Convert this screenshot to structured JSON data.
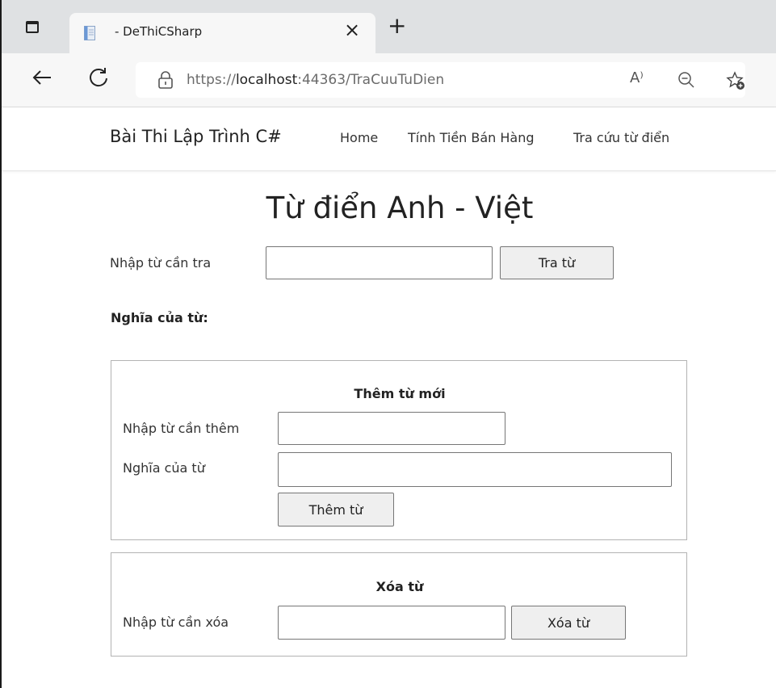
{
  "browser": {
    "tab_title": "- DeThiCSharp",
    "tab_close": "×",
    "new_tab": "+",
    "url_prefix": "https://",
    "url_host": "localhost",
    "url_rest": ":44363/TraCuuTuDien",
    "read_aloud": "A⁾"
  },
  "navbar": {
    "brand": "Bài Thi Lập Trình C#",
    "links": [
      "Home",
      "Tính Tiền Bán Hàng",
      "Tra cứu từ điển"
    ]
  },
  "main": {
    "title": "Từ điển Anh - Việt",
    "search_label": "Nhập từ cần tra",
    "search_value": "",
    "search_button": "Tra từ",
    "meaning_label": "Nghĩa của từ:"
  },
  "add_panel": {
    "title": "Thêm từ mới",
    "word_label": "Nhập từ cần thêm",
    "word_value": "",
    "meaning_label": "Nghĩa của từ",
    "meaning_value": "",
    "button": "Thêm từ"
  },
  "delete_panel": {
    "title": "Xóa từ",
    "word_label": "Nhập từ cần xóa",
    "word_value": "",
    "button": "Xóa từ"
  },
  "icons": {
    "window": "window-icon",
    "favicon": "page-favicon-icon",
    "back": "back-arrow-icon",
    "reload": "reload-icon",
    "lock": "lock-icon",
    "read_aloud": "read-aloud-icon",
    "zoom": "zoom-out-icon",
    "favorites": "add-favorite-icon"
  }
}
